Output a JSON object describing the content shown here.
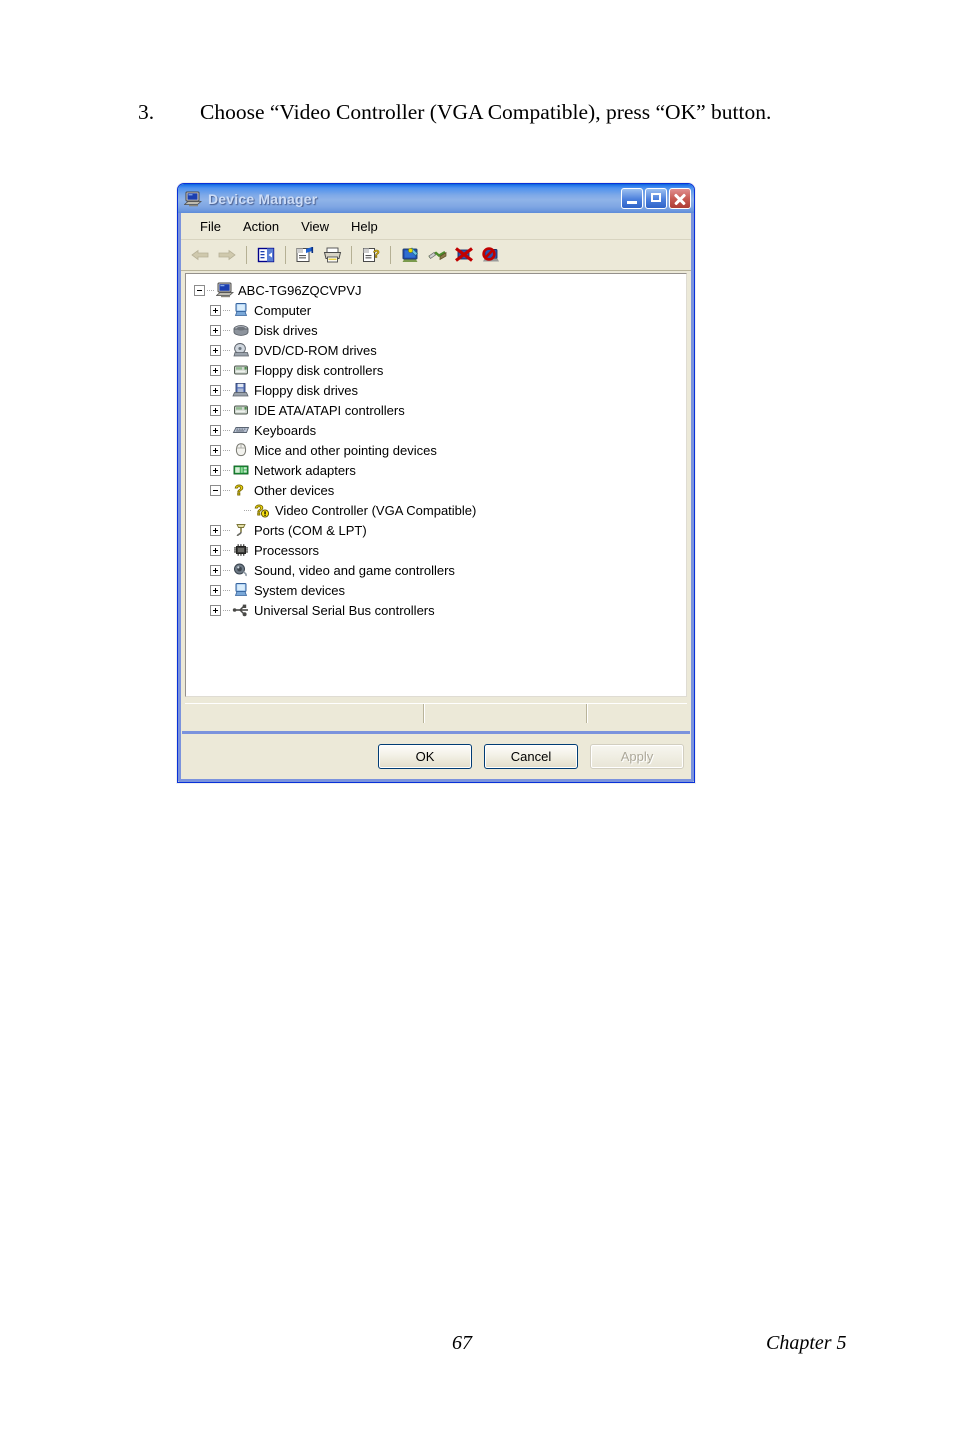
{
  "document": {
    "step_number": "3.",
    "step_text": "Choose “Video Controller (VGA Compatible), press “OK” button.",
    "footer": {
      "page_number": "67",
      "chapter": "Chapter 5"
    }
  },
  "window": {
    "title": "Device Manager",
    "title_icon": "computer-icon",
    "controls": {
      "minimize": "minimize-button",
      "maximize": "maximize-button",
      "close": "close-button"
    },
    "colors": {
      "titlebar_blue": "#8fb3e8",
      "frame_blue": "#7b93dd",
      "face_beige": "#ece9d8",
      "warning_yellow": "#f7df10"
    }
  },
  "menu": {
    "items": [
      {
        "label": "File"
      },
      {
        "label": "Action"
      },
      {
        "label": "View"
      },
      {
        "label": "Help"
      }
    ]
  },
  "toolbar": {
    "items": [
      {
        "name": "back-arrow-icon",
        "tooltip": "Back"
      },
      {
        "name": "forward-arrow-icon",
        "tooltip": "Forward"
      },
      {
        "name": "show-hide-console-tree-icon",
        "tooltip": "Show/Hide Console Tree"
      },
      {
        "name": "properties-icon",
        "tooltip": "Properties"
      },
      {
        "name": "print-icon",
        "tooltip": "Print"
      },
      {
        "name": "help-icon",
        "tooltip": "Help"
      },
      {
        "name": "scan-for-hardware-changes-icon",
        "tooltip": "Scan for hardware changes"
      },
      {
        "name": "update-driver-icon",
        "tooltip": "Update Driver"
      },
      {
        "name": "uninstall-device-icon",
        "tooltip": "Uninstall"
      },
      {
        "name": "disable-device-icon",
        "tooltip": "Disable"
      }
    ]
  },
  "tree": {
    "nodes": [
      {
        "label": "ABC-TG96ZQCVPVJ",
        "level": 0,
        "expander": "minus",
        "icon": "computer-root-icon"
      },
      {
        "label": "Computer",
        "level": 1,
        "expander": "plus",
        "icon": "computer-icon"
      },
      {
        "label": "Disk drives",
        "level": 1,
        "expander": "plus",
        "icon": "disk-drive-icon"
      },
      {
        "label": "DVD/CD-ROM drives",
        "level": 1,
        "expander": "plus",
        "icon": "dvd-drive-icon"
      },
      {
        "label": "Floppy disk controllers",
        "level": 1,
        "expander": "plus",
        "icon": "floppy-controller-icon"
      },
      {
        "label": "Floppy disk drives",
        "level": 1,
        "expander": "plus",
        "icon": "floppy-drive-icon"
      },
      {
        "label": "IDE ATA/ATAPI controllers",
        "level": 1,
        "expander": "plus",
        "icon": "ide-controller-icon"
      },
      {
        "label": "Keyboards",
        "level": 1,
        "expander": "plus",
        "icon": "keyboard-icon"
      },
      {
        "label": "Mice and other pointing devices",
        "level": 1,
        "expander": "plus",
        "icon": "mouse-icon"
      },
      {
        "label": "Network adapters",
        "level": 1,
        "expander": "plus",
        "icon": "network-adapter-icon"
      },
      {
        "label": "Other devices",
        "level": 1,
        "expander": "minus",
        "icon": "unknown-device-icon"
      },
      {
        "label": "Video Controller (VGA Compatible)",
        "level": 2,
        "expander": "none",
        "icon": "unknown-device-warning-icon"
      },
      {
        "label": "Ports (COM & LPT)",
        "level": 1,
        "expander": "plus",
        "icon": "port-icon"
      },
      {
        "label": "Processors",
        "level": 1,
        "expander": "plus",
        "icon": "processor-icon"
      },
      {
        "label": "Sound, video and game controllers",
        "level": 1,
        "expander": "plus",
        "icon": "sound-controller-icon"
      },
      {
        "label": "System devices",
        "level": 1,
        "expander": "plus",
        "icon": "system-device-icon"
      },
      {
        "label": "Universal Serial Bus controllers",
        "level": 1,
        "expander": "plus",
        "icon": "usb-controller-icon"
      }
    ]
  },
  "status_bar": {
    "panes": [
      "",
      "",
      ""
    ]
  },
  "buttons": {
    "ok": "OK",
    "cancel": "Cancel",
    "apply": "Apply",
    "apply_disabled": true
  }
}
